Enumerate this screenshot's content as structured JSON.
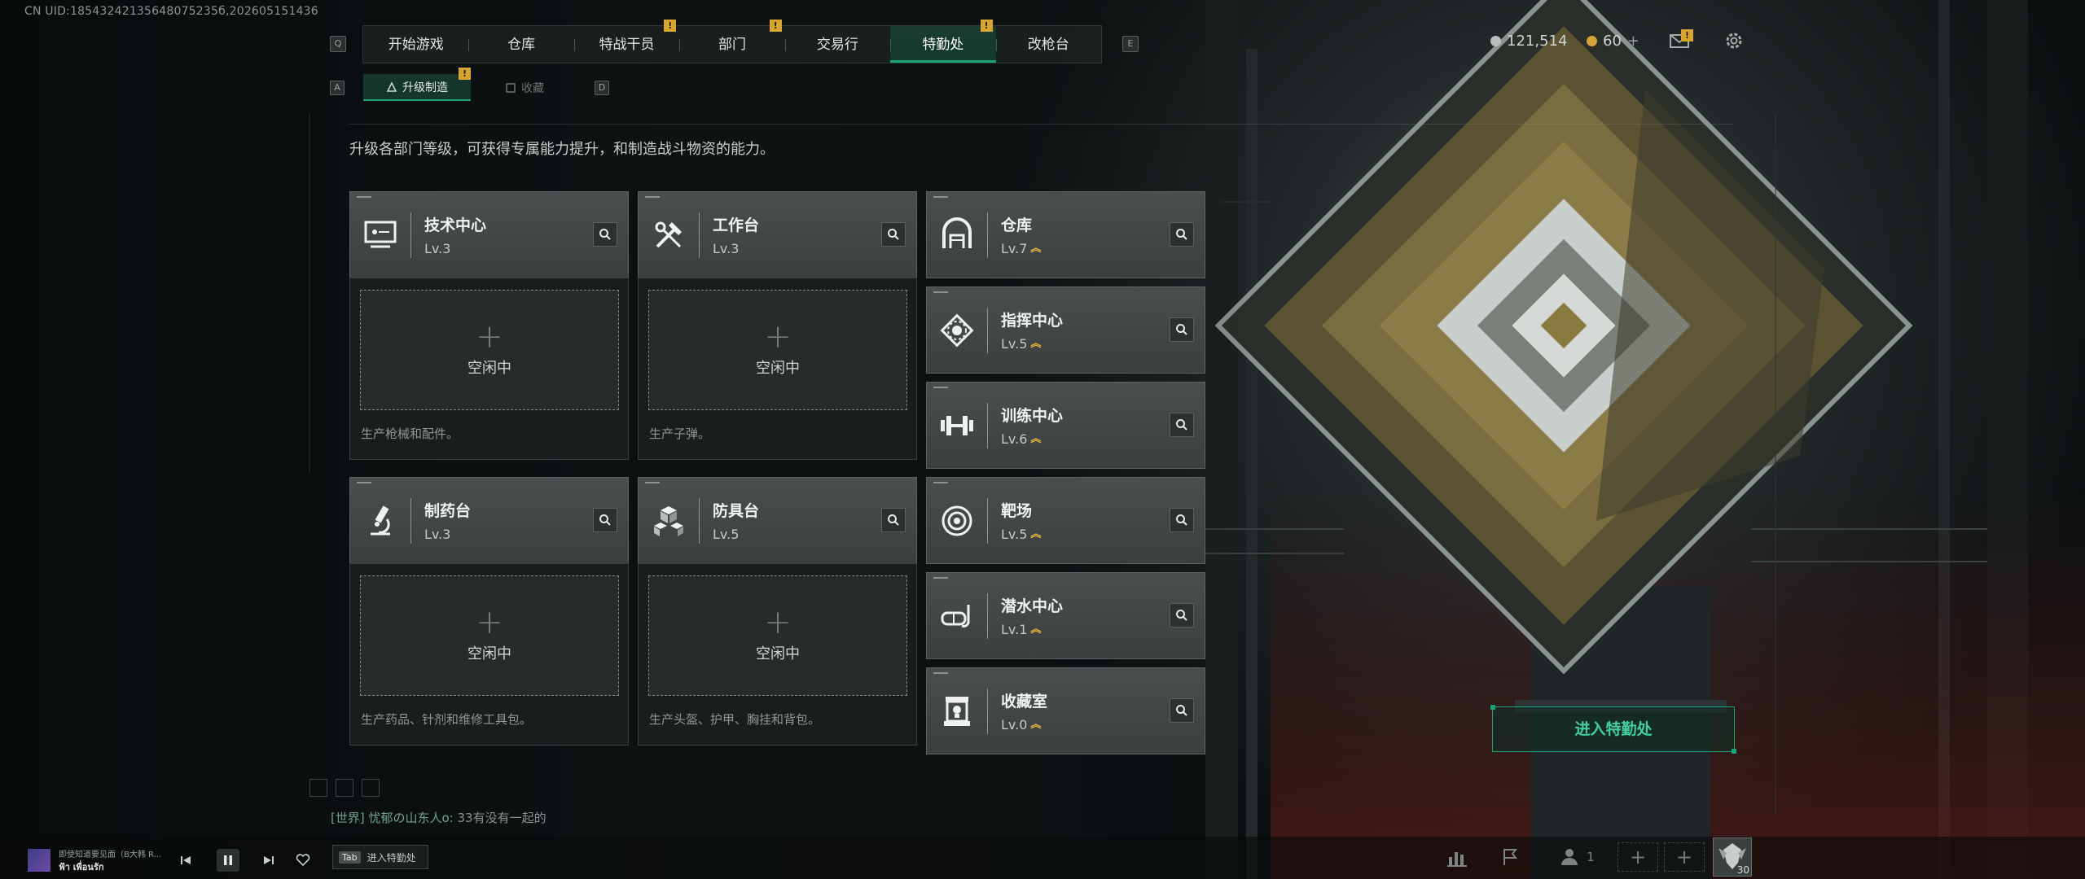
{
  "uid_text": "CN UID:18543242135648075235б,202605151436",
  "nav": {
    "key_left": "Q",
    "key_right": "E",
    "tabs": [
      {
        "label": "开始游戏"
      },
      {
        "label": "仓库"
      },
      {
        "label": "特战干员",
        "badge": "!"
      },
      {
        "label": "部门",
        "badge": "!"
      },
      {
        "label": "交易行"
      },
      {
        "label": "特勤处",
        "badge": "!",
        "active": true
      },
      {
        "label": "改枪台"
      }
    ]
  },
  "subnav": {
    "key_left": "A",
    "key_right": "D",
    "tabs": [
      {
        "label": "升级制造",
        "badge": "!",
        "active": true,
        "icon": "upgrade-icon"
      },
      {
        "label": "收藏",
        "icon": "collection-icon"
      }
    ]
  },
  "currency": {
    "coins": "121,514",
    "tokens": "60",
    "plus": "+"
  },
  "description": "升级各部门等级，可获得专属能力提升，和制造战斗物资的能力。",
  "idle_label": "空闲中",
  "plus_symbol": "+",
  "production": [
    {
      "name": "技术中心",
      "level": "Lv.3",
      "icon": "computer-icon",
      "desc": "生产枪械和配件。"
    },
    {
      "name": "工作台",
      "level": "Lv.3",
      "icon": "tools-icon",
      "desc": "生产子弹。"
    },
    {
      "name": "制药台",
      "level": "Lv.3",
      "icon": "microscope-icon",
      "desc": "生产药品、针剂和维修工具包。"
    },
    {
      "name": "防具台",
      "level": "Lv.5",
      "icon": "cubes-icon",
      "desc": "生产头盔、护甲、胸挂和背包。"
    }
  ],
  "facilities": [
    {
      "name": "仓库",
      "level": "Lv.7",
      "icon": "warehouse-icon"
    },
    {
      "name": "指挥中心",
      "level": "Lv.5",
      "icon": "command-icon"
    },
    {
      "name": "训练中心",
      "level": "Lv.6",
      "icon": "dumbbell-icon"
    },
    {
      "name": "靶场",
      "level": "Lv.5",
      "icon": "target-icon"
    },
    {
      "name": "潜水中心",
      "level": "Lv.1",
      "icon": "diving-mask-icon"
    },
    {
      "name": "收藏室",
      "level": "Lv.0",
      "icon": "trophy-case-icon"
    }
  ],
  "level_up_arrow": "︽",
  "enter_button": "进入特勤处",
  "chat": {
    "channel": "[世界]",
    "user": "忧郁の山东人o:",
    "message": "33有没有一起的"
  },
  "music": {
    "title": "即使知道要见面（B大韩 R...",
    "artist": "ฟ้า เพื่อนรัก"
  },
  "tab_hint": {
    "key": "Tab",
    "label": "进入特勤处"
  },
  "squad_count": "1",
  "avatar_level": "30",
  "colors": {
    "accent_green": "#1ea277",
    "badge_yellow": "#d9a62c",
    "level_arrow": "#e5b63a"
  }
}
